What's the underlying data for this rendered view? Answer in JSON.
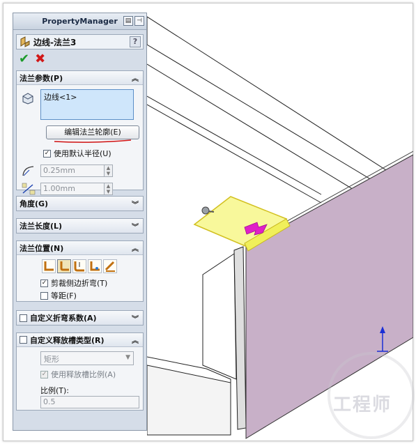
{
  "panel": {
    "header_title": "PropertyManager",
    "feature_title": "边线-法兰3",
    "help_label": "?"
  },
  "flange_params": {
    "group_label": "法兰参数(P)",
    "selection_item": "边线<1>",
    "edit_profile_button": "编辑法兰轮廓(E)",
    "use_default_radius_label": "使用默认半径(U)",
    "use_default_radius_checked": true,
    "radius_value": "0.25mm",
    "gap_value": "1.00mm"
  },
  "angle_group": {
    "label": "角度(G)"
  },
  "flange_length_group": {
    "label": "法兰长度(L)"
  },
  "flange_position": {
    "label": "法兰位置(N)",
    "trim_side_bends_label": "剪裁侧边折弯(T)",
    "trim_side_bends_checked": true,
    "offset_label": "等距(F)",
    "offset_checked": false
  },
  "custom_bend_allowance": {
    "label": "自定义折弯系数(A)"
  },
  "custom_relief": {
    "label": "自定义释放槽类型(R)",
    "type_value": "矩形",
    "use_relief_ratio_label": "使用释放槽比例(A)",
    "ratio_label": "比例(T):",
    "ratio_value": "0.5"
  },
  "watermark": {
    "text": "工程师"
  },
  "colors": {
    "panel_bg": "#d5dde8",
    "selection_bg": "#cfe6fb",
    "face_purple": "#c8b0c8",
    "highlight_yellow": "#f5f57a",
    "accent_magenta": "#e020c8",
    "axis_blue": "#1a2fd6"
  }
}
